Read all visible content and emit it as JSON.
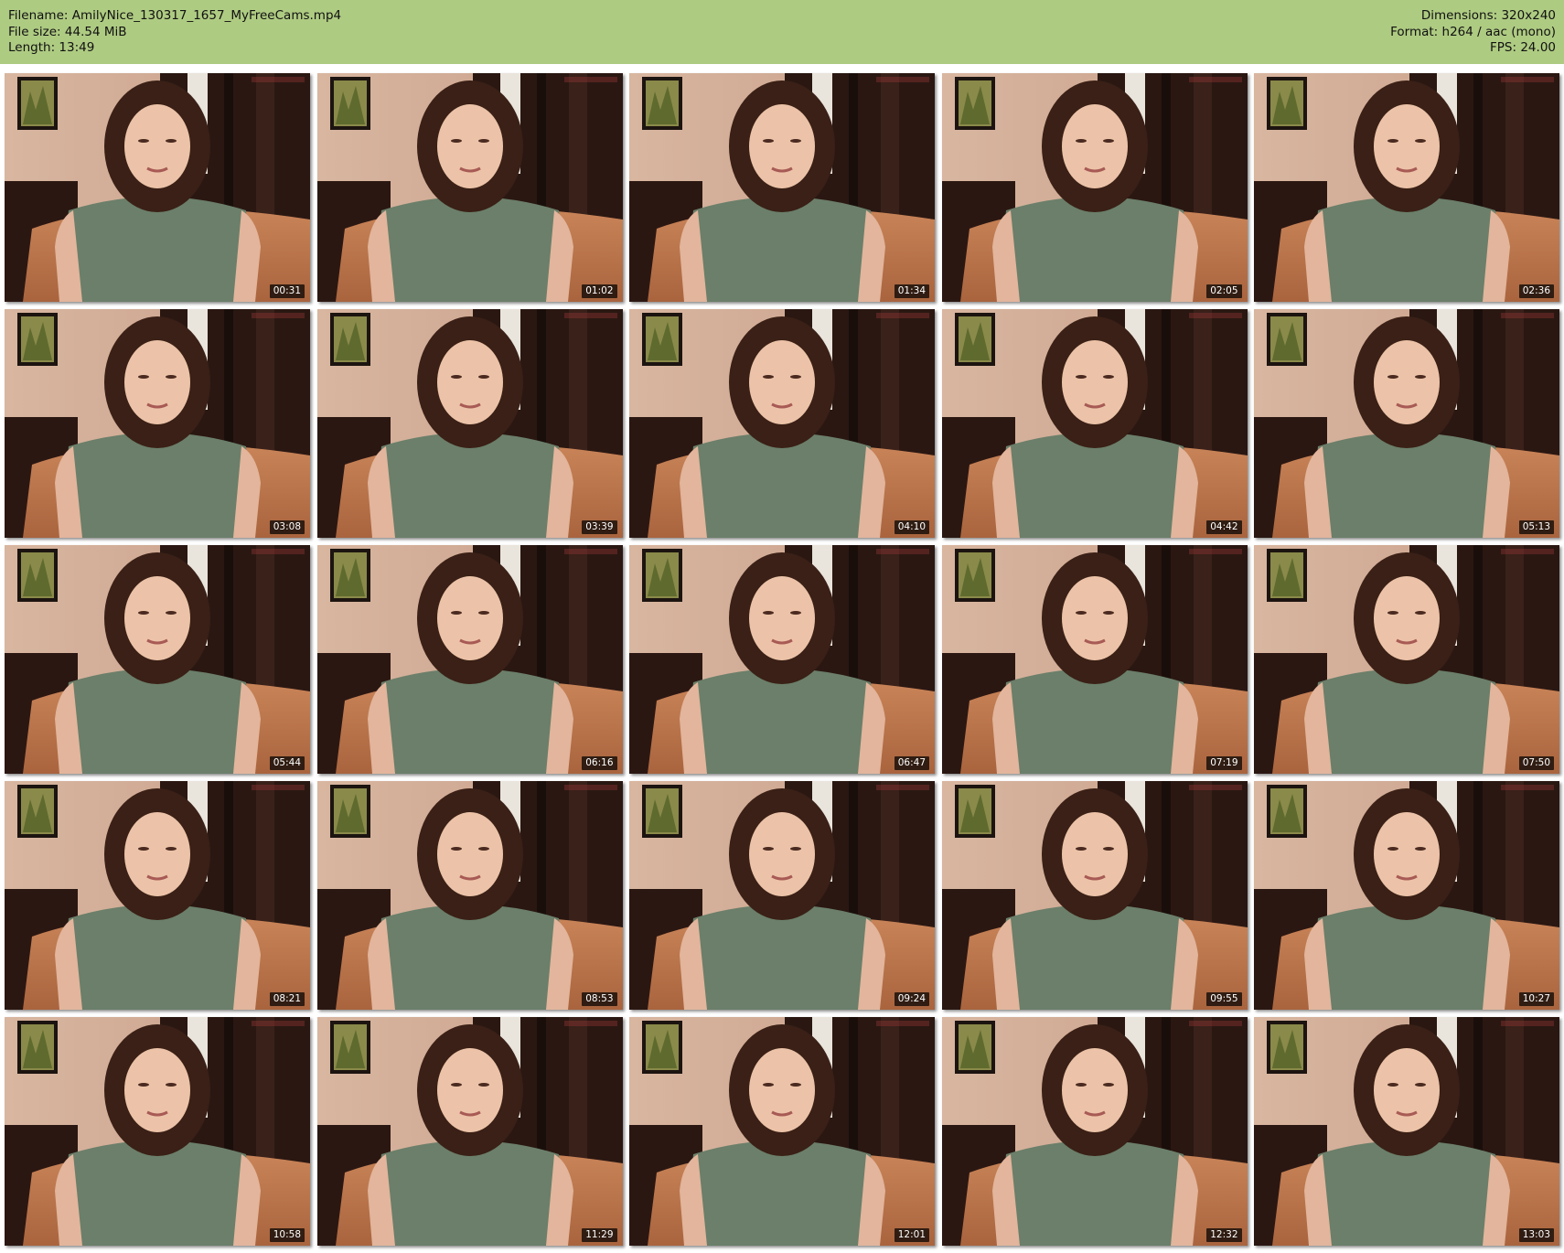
{
  "header": {
    "filename_label": "Filename:",
    "filename": "AmilyNice_130317_1657_MyFreeCams.mp4",
    "filesize_label": "File size:",
    "filesize": "44.54 MiB",
    "length_label": "Length:",
    "length": "13:49",
    "dimensions_label": "Dimensions:",
    "dimensions": "320x240",
    "format_label": "Format:",
    "format": "h264 / aac (mono)",
    "fps_label": "FPS:",
    "fps": "24.00"
  },
  "colors": {
    "header_bg": "#aecb82",
    "timestamp_bg": "#000000",
    "timestamp_text": "#ffffff"
  },
  "thumbnails": [
    {
      "timestamp": "00:31"
    },
    {
      "timestamp": "01:02"
    },
    {
      "timestamp": "01:34"
    },
    {
      "timestamp": "02:05"
    },
    {
      "timestamp": "02:36"
    },
    {
      "timestamp": "03:08"
    },
    {
      "timestamp": "03:39"
    },
    {
      "timestamp": "04:10"
    },
    {
      "timestamp": "04:42"
    },
    {
      "timestamp": "05:13"
    },
    {
      "timestamp": "05:44"
    },
    {
      "timestamp": "06:16"
    },
    {
      "timestamp": "06:47"
    },
    {
      "timestamp": "07:19"
    },
    {
      "timestamp": "07:50"
    },
    {
      "timestamp": "08:21"
    },
    {
      "timestamp": "08:53"
    },
    {
      "timestamp": "09:24"
    },
    {
      "timestamp": "09:55"
    },
    {
      "timestamp": "10:27"
    },
    {
      "timestamp": "10:58"
    },
    {
      "timestamp": "11:29"
    },
    {
      "timestamp": "12:01"
    },
    {
      "timestamp": "12:32"
    },
    {
      "timestamp": "13:03"
    }
  ]
}
